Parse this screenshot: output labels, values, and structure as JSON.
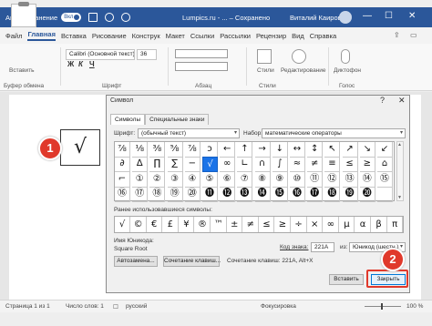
{
  "titlebar": {
    "autosave_label": "Автосохранение",
    "toggle_text": "Вкл",
    "document": "Lumpics.ru - ... – Сохранено",
    "user": "Виталий Каиров",
    "minimize": "—",
    "maximize": "☐",
    "close": "✕"
  },
  "menu": {
    "items": [
      "Файл",
      "Главная",
      "Вставка",
      "Рисование",
      "Конструк",
      "Макет",
      "Ссылки",
      "Рассылки",
      "Рецензир",
      "Вид",
      "Справка"
    ],
    "active_index": 1,
    "share_icon": "share-icon",
    "comment_icon": "comment-icon"
  },
  "ribbon": {
    "paste_label": "Вставить",
    "clipboard_group": "Буфер обмена",
    "font_name": "Calibri (Основной текст)",
    "font_size": "36",
    "font_group": "Шрифт",
    "format_buttons": [
      "Ж",
      "К",
      "Ч"
    ],
    "paragraph_group": "Абзац",
    "styles_label": "Стили",
    "styles_group": "Стили",
    "editing_label": "Редактирование",
    "dictate_label": "Диктофон",
    "voice_group": "Голос"
  },
  "document": {
    "inserted_symbol": "√"
  },
  "badges": {
    "step1": "1",
    "step2": "2"
  },
  "dialog": {
    "title": "Символ",
    "help": "?",
    "close": "✕",
    "tabs": [
      "Символы",
      "Специальные знаки"
    ],
    "active_tab": 0,
    "font_label": "Шрифт:",
    "font_value": "(обычный текст)",
    "subset_label": "Набор:",
    "subset_value": "математические операторы",
    "symbols": [
      [
        "⅞",
        "⅛",
        "⅜",
        "⅝",
        "⅞",
        "ↄ",
        "←",
        "↑",
        "→",
        "↓",
        "↔",
        "↕",
        "↖",
        "↗",
        "↘",
        "↙"
      ],
      [
        "∂",
        "∆",
        "∏",
        "∑",
        "−",
        "√",
        "∞",
        "∟",
        "∩",
        "∫",
        "≈",
        "≠",
        "≡",
        "≤",
        "≥",
        "⌂"
      ],
      [
        "⌐",
        "①",
        "②",
        "③",
        "④",
        "⑤",
        "⑥",
        "⑦",
        "⑧",
        "⑨",
        "⑩",
        "⑪",
        "⑫",
        "⑬",
        "⑭",
        "⑮"
      ],
      [
        "⑯",
        "⑰",
        "⑱",
        "⑲",
        "⑳",
        "⓫",
        "⓬",
        "⓭",
        "⓮",
        "⓯",
        "⓰",
        "⓱",
        "⓲",
        "⓳",
        "⓴",
        ""
      ]
    ],
    "selected_symbol": "√",
    "recent_label": "Ранее использовавшиеся символы:",
    "recent": [
      "√",
      "©",
      "€",
      "£",
      "¥",
      "®",
      "™",
      "±",
      "≠",
      "≤",
      "≥",
      "÷",
      "×",
      "∞",
      "µ",
      "α",
      "β",
      "π"
    ],
    "unicode_name_label": "Имя Юникода:",
    "unicode_name": "Square Root",
    "code_label": "Код знака:",
    "code_value": "221A",
    "from_label": "из:",
    "from_value": "Юникод (шестн.)",
    "autocorrect_button": "Автозамена...",
    "shortcut_button": "Сочетание клавиш...",
    "shortcut_text": "Сочетание клавиш: 221A, Alt+X",
    "insert_button": "Вставить",
    "close_button": "Закрыть"
  },
  "status": {
    "page": "Страница 1 из 1",
    "words": "Число слов: 1",
    "language": "русский",
    "focus": "Фокусировка",
    "zoom": "100 %"
  },
  "colors": {
    "titlebar": "#2b579a",
    "badge": "#e0392b",
    "selection": "#1a73e8"
  }
}
